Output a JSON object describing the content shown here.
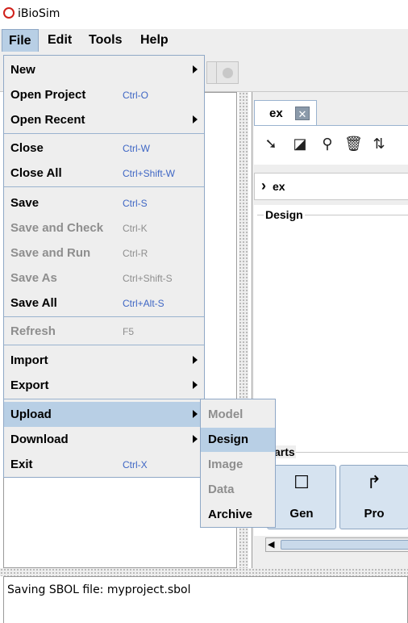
{
  "window": {
    "title": "iBioSim"
  },
  "menubar": {
    "items": [
      "File",
      "Edit",
      "Tools",
      "Help"
    ]
  },
  "file_menu": {
    "items": [
      {
        "label": "New",
        "shortcut": "",
        "submenu": true,
        "enabled": true
      },
      {
        "label": "Open Project",
        "shortcut": "Ctrl-O",
        "submenu": false,
        "enabled": true
      },
      {
        "label": "Open Recent",
        "shortcut": "",
        "submenu": true,
        "enabled": true
      },
      {
        "label": "Close",
        "shortcut": "Ctrl-W",
        "submenu": false,
        "enabled": true
      },
      {
        "label": "Close All",
        "shortcut": "Ctrl+Shift-W",
        "submenu": false,
        "enabled": true
      },
      {
        "label": "Save",
        "shortcut": "Ctrl-S",
        "submenu": false,
        "enabled": true
      },
      {
        "label": "Save and Check",
        "shortcut": "Ctrl-K",
        "submenu": false,
        "enabled": false
      },
      {
        "label": "Save and Run",
        "shortcut": "Ctrl-R",
        "submenu": false,
        "enabled": false
      },
      {
        "label": "Save As",
        "shortcut": "Ctrl+Shift-S",
        "submenu": false,
        "enabled": false
      },
      {
        "label": "Save All",
        "shortcut": "Ctrl+Alt-S",
        "submenu": false,
        "enabled": true
      },
      {
        "label": "Refresh",
        "shortcut": "F5",
        "submenu": false,
        "enabled": false
      },
      {
        "label": "Import",
        "shortcut": "",
        "submenu": true,
        "enabled": true
      },
      {
        "label": "Export",
        "shortcut": "",
        "submenu": true,
        "enabled": true
      },
      {
        "label": "Upload",
        "shortcut": "",
        "submenu": true,
        "enabled": true,
        "highlighted": true
      },
      {
        "label": "Download",
        "shortcut": "",
        "submenu": true,
        "enabled": true
      },
      {
        "label": "Exit",
        "shortcut": "Ctrl-X",
        "submenu": false,
        "enabled": true
      }
    ]
  },
  "upload_submenu": {
    "items": [
      {
        "label": "Model",
        "enabled": false
      },
      {
        "label": "Design",
        "enabled": true,
        "highlighted": true
      },
      {
        "label": "Image",
        "enabled": false
      },
      {
        "label": "Data",
        "enabled": false
      },
      {
        "label": "Archive",
        "enabled": true
      }
    ]
  },
  "editor": {
    "tab_label": "ex",
    "breadcrumb": "ex",
    "design_label": "Design",
    "parts_label": "arts",
    "part_buttons": [
      {
        "label": "Gen",
        "icon": "square-outline-icon"
      },
      {
        "label": "Pro",
        "icon": "promoter-arrow-icon"
      }
    ],
    "tool_icons": [
      "select-pointer-icon",
      "box-select-icon",
      "zoom-icon",
      "trash-icon",
      "flip-icon"
    ]
  },
  "log": {
    "text": "Saving SBOL file: myproject.sbol"
  },
  "colors": {
    "menu_highlight": "#b8cfe5",
    "shortcut_text": "#3e66c4",
    "disabled_text": "#8e8e8e",
    "app_icon": "#d0201a"
  }
}
